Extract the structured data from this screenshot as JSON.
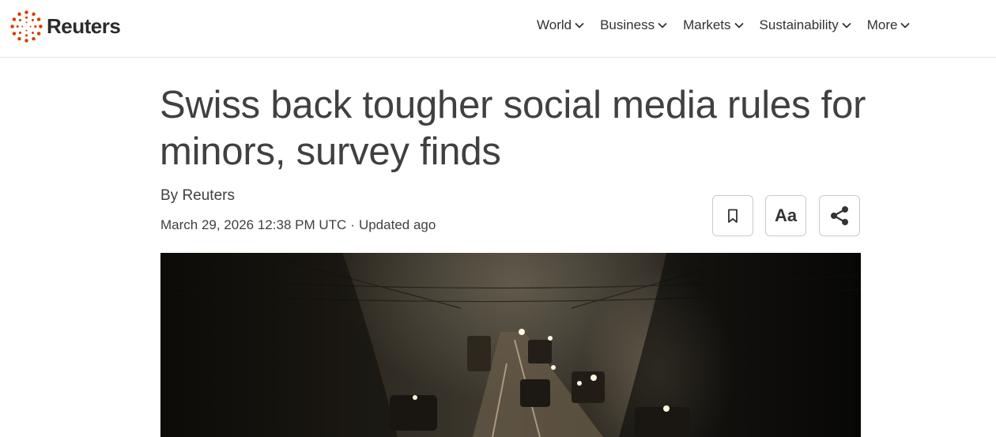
{
  "brand": {
    "name": "Reuters",
    "accent": "#d64000"
  },
  "nav": {
    "items": [
      {
        "label": "World"
      },
      {
        "label": "Business"
      },
      {
        "label": "Markets"
      },
      {
        "label": "Sustainability"
      },
      {
        "label": "More"
      }
    ]
  },
  "article": {
    "headline": "Swiss back tougher social media rules for minors, survey finds",
    "byline": "By Reuters",
    "date": "March 29, 2026 12:38 PM UTC",
    "separator": "·",
    "updated": "Updated ago",
    "tools": {
      "bookmark_icon": "bookmark-icon",
      "text_size_label": "Aa",
      "share_icon": "share-icon"
    },
    "image_description": "traffic-street-photo"
  }
}
